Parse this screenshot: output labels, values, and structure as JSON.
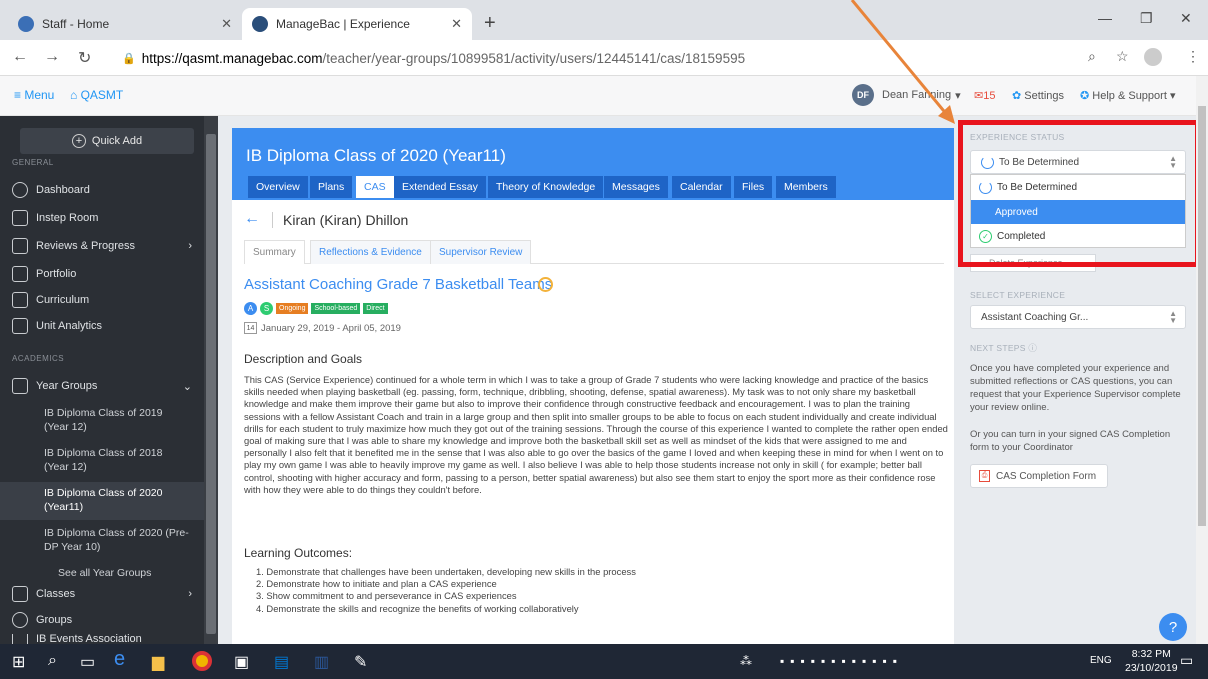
{
  "browser": {
    "tabs": [
      {
        "title": "Staff - Home"
      },
      {
        "title": "ManageBac | Experience"
      }
    ],
    "url_host": "https://qasmt.managebac.com",
    "url_path": "/teacher/year-groups/10899581/activity/users/12445141/cas/18159595"
  },
  "topbar": {
    "menu": "≡ Menu",
    "brand": "QASMT",
    "user_initials": "DF",
    "user_name": "Dean Fanning",
    "mail_count": "15",
    "settings": "Settings",
    "help": "Help & Support"
  },
  "sidebar": {
    "quick_add": "Quick Add",
    "general": "GENERAL",
    "items": [
      "Dashboard",
      "Instep Room",
      "Reviews & Progress",
      "Portfolio",
      "Curriculum",
      "Unit Analytics"
    ],
    "academics": "ACADEMICS",
    "year_groups": "Year Groups",
    "sub_items": [
      "IB Diploma Class of 2019 (Year 12)",
      "IB Diploma Class of 2018 (Year 12)",
      "IB Diploma Class of 2020 (Year11)",
      "IB Diploma Class of 2020 (Pre-DP Year 10)"
    ],
    "see_all": "See all Year Groups",
    "classes": "Classes",
    "groups": "Groups",
    "ib_events": "IB Events Association"
  },
  "main": {
    "class_title": "IB Diploma Class of 2020 (Year11)",
    "tabs": [
      "Overview",
      "Plans",
      "CAS",
      "Extended Essay",
      "Theory of Knowledge",
      "Messages",
      "Calendar",
      "Files",
      "Members"
    ],
    "student": "Kiran (Kiran) Dhillon",
    "subtabs": [
      "Summary",
      "Reflections & Evidence",
      "Supervisor Review"
    ],
    "experience_title": "Assistant Coaching Grade 7 Basketball Teams",
    "badges": {
      "a": "A",
      "s": "S",
      "t1": "Ongoing",
      "t2": "School-based",
      "t3": "Direct"
    },
    "cal_day": "14",
    "dates": "January 29, 2019 - April 05, 2019",
    "desc_heading": "Description and Goals",
    "description": "This CAS (Service Experience) continued for a whole term in which I was to take a group of Grade 7 students who were lacking knowledge and practice of the basics skills needed when playing basketball (eg. passing, form, technique, dribbling, shooting, defense, spatial awareness). My task was to not only share my basketball knowledge and make them improve their game but also to improve their confidence through constructive feedback and encouragement. I was to plan the training sessions with a fellow Assistant Coach and train in a large group and then split into smaller groups to be able to focus on each student individually and create individual drills for each student to truly maximize how much they got out of the training sessions. Through the course of this experience I wanted to complete the rather open ended goal of making sure that I was able to share my knowledge and improve both the basketball skill set as well as mindset of the kids that were assigned to me and personally I also felt that it benefited me in the sense that I was also able to go over the basics of the game I loved and when keeping these in mind for when I went on to play my own game I was able to heavily improve my game as well. I also believe I was able to help those students increase not only in skill ( for example; better ball control, shooting with higher accuracy and form, passing to a person, better spatial awareness) but also see them start to enjoy the sport more as their confidence rose with how they were able to do things they couldn't before.",
    "outcomes_heading": "Learning Outcomes:",
    "outcomes": [
      "1. Demonstrate that challenges have been undertaken, developing new skills in the process",
      "2. Demonstrate how to initiate and plan a CAS experience",
      "3. Show commitment to and perseverance in CAS experiences",
      "4. Demonstrate the skills and recognize the benefits of working collaboratively"
    ]
  },
  "right": {
    "status_label": "EXPERIENCE STATUS",
    "status_value": "To Be Determined",
    "options": [
      "To Be Determined",
      "Approved",
      "Completed"
    ],
    "delete": "Delete Experience",
    "select_label": "SELECT EXPERIENCE",
    "select_value": "Assistant Coaching Gr...",
    "next_label": "NEXT STEPS",
    "next_text1": "Once you have completed your experience and submitted reflections or CAS questions, you can request that your Experience Supervisor complete your review online.",
    "next_text2": "Or you can turn in your signed CAS Completion form to your Coordinator",
    "cas_form": "CAS Completion Form"
  },
  "taskbar": {
    "lang": "ENG",
    "time": "8:32 PM",
    "date": "23/10/2019"
  }
}
